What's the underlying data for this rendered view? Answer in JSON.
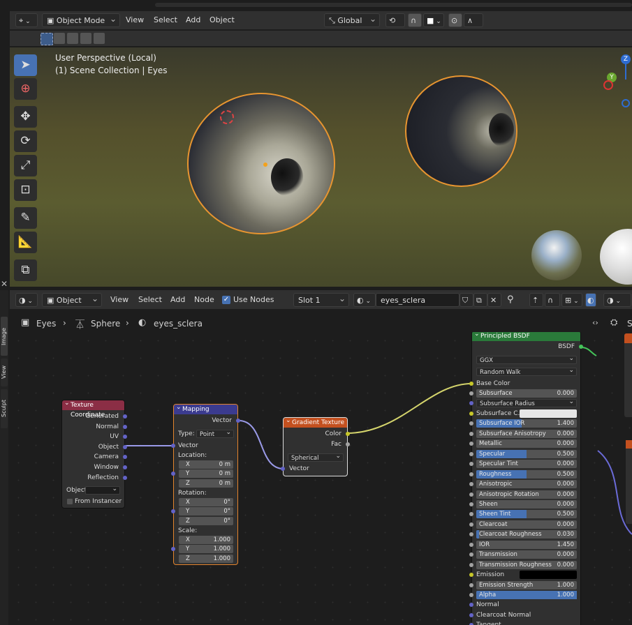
{
  "viewport_header": {
    "mode": "Object Mode",
    "menus": [
      "View",
      "Select",
      "Add",
      "Object"
    ],
    "transform_orientation": "Global"
  },
  "viewport": {
    "perspective": "User Perspective (Local)",
    "collection": "(1) Scene Collection | Eyes",
    "gizmo": {
      "z": "Z",
      "y": "Y"
    }
  },
  "node_header": {
    "editor_type": "Object",
    "menus": [
      "View",
      "Select",
      "Add",
      "Node"
    ],
    "use_nodes_label": "Use Nodes",
    "slot": "Slot 1",
    "material": "eyes_sclera"
  },
  "breadcrumb": {
    "object": "Eyes",
    "mesh": "Sphere",
    "material": "eyes_sclera",
    "right_partial": "S"
  },
  "left_tabs": [
    "Image",
    "View",
    "Sculpt"
  ],
  "nodes": {
    "texture_coordinate": {
      "title": "Texture Coordinate",
      "outputs": [
        "Generated",
        "Normal",
        "UV",
        "Object",
        "Camera",
        "Window",
        "Reflection"
      ],
      "object_label": "Object",
      "from_instancer": "From Instancer"
    },
    "mapping": {
      "title": "Mapping",
      "output": "Vector",
      "type_label": "Type:",
      "type_value": "Point",
      "vector_input": "Vector",
      "location_label": "Location:",
      "location": [
        {
          "axis": "X",
          "value": "0 m"
        },
        {
          "axis": "Y",
          "value": "0 m"
        },
        {
          "axis": "Z",
          "value": "0 m"
        }
      ],
      "rotation_label": "Rotation:",
      "rotation": [
        {
          "axis": "X",
          "value": "0°"
        },
        {
          "axis": "Y",
          "value": "0°"
        },
        {
          "axis": "Z",
          "value": "0°"
        }
      ],
      "scale_label": "Scale:",
      "scale": [
        {
          "axis": "X",
          "value": "1.000"
        },
        {
          "axis": "Y",
          "value": "1.000"
        },
        {
          "axis": "Z",
          "value": "1.000"
        }
      ]
    },
    "gradient_texture": {
      "title": "Gradient Texture",
      "outputs": [
        "Color",
        "Fac"
      ],
      "gradient_type": "Spherical",
      "vector_input": "Vector"
    },
    "principled_bsdf": {
      "title": "Principled BSDF",
      "output": "BSDF",
      "distribution": "GGX",
      "subsurface_method": "Random Walk",
      "base_color": "Base Color",
      "params": [
        {
          "label": "Subsurface",
          "value": "0.000",
          "fill": 0,
          "socket": "#a1a1a1"
        },
        {
          "label": "Subsurface Radius",
          "value": "",
          "fill": 0,
          "socket": "#6363c7",
          "dropdown": true
        },
        {
          "label": "Subsurface C...",
          "value": "",
          "fill": 0,
          "socket": "#c7c729",
          "color": "#e6e6e6"
        },
        {
          "label": "Subsurface IOR",
          "value": "1.400",
          "fill": 0.45,
          "socket": "#a1a1a1"
        },
        {
          "label": "Subsurface Anisotropy",
          "value": "0.000",
          "fill": 0,
          "socket": "#a1a1a1"
        },
        {
          "label": "Metallic",
          "value": "0.000",
          "fill": 0,
          "socket": "#a1a1a1"
        },
        {
          "label": "Specular",
          "value": "0.500",
          "fill": 0.5,
          "socket": "#a1a1a1"
        },
        {
          "label": "Specular Tint",
          "value": "0.000",
          "fill": 0,
          "socket": "#a1a1a1"
        },
        {
          "label": "Roughness",
          "value": "0.500",
          "fill": 0.5,
          "socket": "#a1a1a1"
        },
        {
          "label": "Anisotropic",
          "value": "0.000",
          "fill": 0,
          "socket": "#a1a1a1"
        },
        {
          "label": "Anisotropic Rotation",
          "value": "0.000",
          "fill": 0,
          "socket": "#a1a1a1"
        },
        {
          "label": "Sheen",
          "value": "0.000",
          "fill": 0,
          "socket": "#a1a1a1"
        },
        {
          "label": "Sheen Tint",
          "value": "0.500",
          "fill": 0.5,
          "socket": "#a1a1a1"
        },
        {
          "label": "Clearcoat",
          "value": "0.000",
          "fill": 0,
          "socket": "#a1a1a1"
        },
        {
          "label": "Clearcoat Roughness",
          "value": "0.030",
          "fill": 0.03,
          "socket": "#a1a1a1"
        },
        {
          "label": "IOR",
          "value": "1.450",
          "fill": 0,
          "socket": "#a1a1a1"
        },
        {
          "label": "Transmission",
          "value": "0.000",
          "fill": 0,
          "socket": "#a1a1a1"
        },
        {
          "label": "Transmission Roughness",
          "value": "0.000",
          "fill": 0,
          "socket": "#a1a1a1"
        },
        {
          "label": "Emission",
          "value": "",
          "fill": 0,
          "socket": "#c7c729",
          "color": "#000000",
          "plain": true
        },
        {
          "label": "Emission Strength",
          "value": "1.000",
          "fill": 0,
          "socket": "#a1a1a1"
        },
        {
          "label": "Alpha",
          "value": "1.000",
          "fill": 1,
          "socket": "#a1a1a1"
        },
        {
          "label": "Normal",
          "value": "",
          "fill": 0,
          "socket": "#6363c7",
          "plain": true
        },
        {
          "label": "Clearcoat Normal",
          "value": "",
          "fill": 0,
          "socket": "#6363c7",
          "plain": true
        },
        {
          "label": "Tangent",
          "value": "",
          "fill": 0,
          "socket": "#6363c7",
          "plain": true
        }
      ]
    }
  },
  "colors": {
    "accent": "#4772b3",
    "selection_outline": "#e3842d",
    "texture_node_header": "#c3501f",
    "mapping_header": "#3b3b8f",
    "input_header": "#8b2e45",
    "shader_header": "#2a7a3a"
  }
}
